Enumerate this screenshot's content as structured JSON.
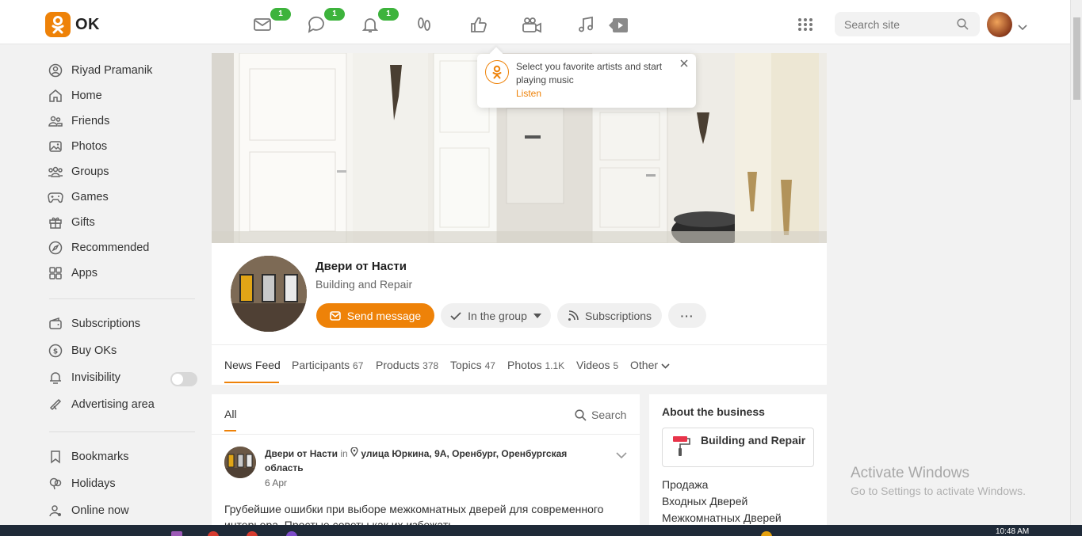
{
  "topbar": {
    "logo_text": "OK",
    "badges": [
      "1",
      "1",
      "1"
    ],
    "search_placeholder": "Search site"
  },
  "sidebar": {
    "items": [
      {
        "label": "Riyad Pramanik",
        "icon": "user-icon"
      },
      {
        "label": "Home",
        "icon": "home-icon"
      },
      {
        "label": "Friends",
        "icon": "friends-icon"
      },
      {
        "label": "Photos",
        "icon": "photo-icon"
      },
      {
        "label": "Groups",
        "icon": "groups-icon"
      },
      {
        "label": "Games",
        "icon": "gamepad-icon"
      },
      {
        "label": "Gifts",
        "icon": "gift-icon"
      },
      {
        "label": "Recommended",
        "icon": "compass-icon"
      },
      {
        "label": "Apps",
        "icon": "apps-icon"
      }
    ],
    "items2": [
      {
        "label": "Subscriptions",
        "icon": "wallet-icon"
      },
      {
        "label": "Buy OKs",
        "icon": "coin-icon"
      },
      {
        "label": "Invisibility",
        "icon": "invisibility-icon",
        "toggle": false
      },
      {
        "label": "Advertising area",
        "icon": "megaphone-icon"
      }
    ],
    "items3": [
      {
        "label": "Bookmarks",
        "icon": "bookmark-icon"
      },
      {
        "label": "Holidays",
        "icon": "balloon-icon"
      },
      {
        "label": "Online now",
        "icon": "online-icon"
      }
    ]
  },
  "tooltip": {
    "text": "Select you favorite artists and start playing music",
    "link": "Listen"
  },
  "group": {
    "name": "Двери от Насти",
    "category": "Building and Repair",
    "send_message": "Send message",
    "in_group": "In the group",
    "subscriptions": "Subscriptions",
    "more": "···"
  },
  "tabs": [
    {
      "label": "News Feed",
      "count": ""
    },
    {
      "label": "Participants",
      "count": "67"
    },
    {
      "label": "Products",
      "count": "378"
    },
    {
      "label": "Topics",
      "count": "47"
    },
    {
      "label": "Photos",
      "count": "1.1K"
    },
    {
      "label": "Videos",
      "count": "5"
    },
    {
      "label": "Other",
      "count": ""
    }
  ],
  "feed": {
    "filter_all": "All",
    "search": "Search",
    "post": {
      "author": "Двери от Насти",
      "in_word": "in",
      "location": "улица Юркина, 9А, Оренбург, Оренбургская область",
      "date": "6 Apr",
      "text": "Грубейшие ошибки при выборе межкомнатных дверей для современного интерьера. Простые советы как их избежать"
    }
  },
  "about": {
    "title": "About the business",
    "category": "Building and Repair",
    "lines": [
      "Продажа",
      "Входных Дверей",
      "Межкомнатных Дверей"
    ]
  },
  "watermark": {
    "line1": "Activate Windows",
    "line2": "Go to Settings to activate Windows."
  },
  "taskbar": {
    "time": "10:48 AM"
  },
  "colors": {
    "accent": "#ee8208",
    "badge": "#3db33c"
  }
}
